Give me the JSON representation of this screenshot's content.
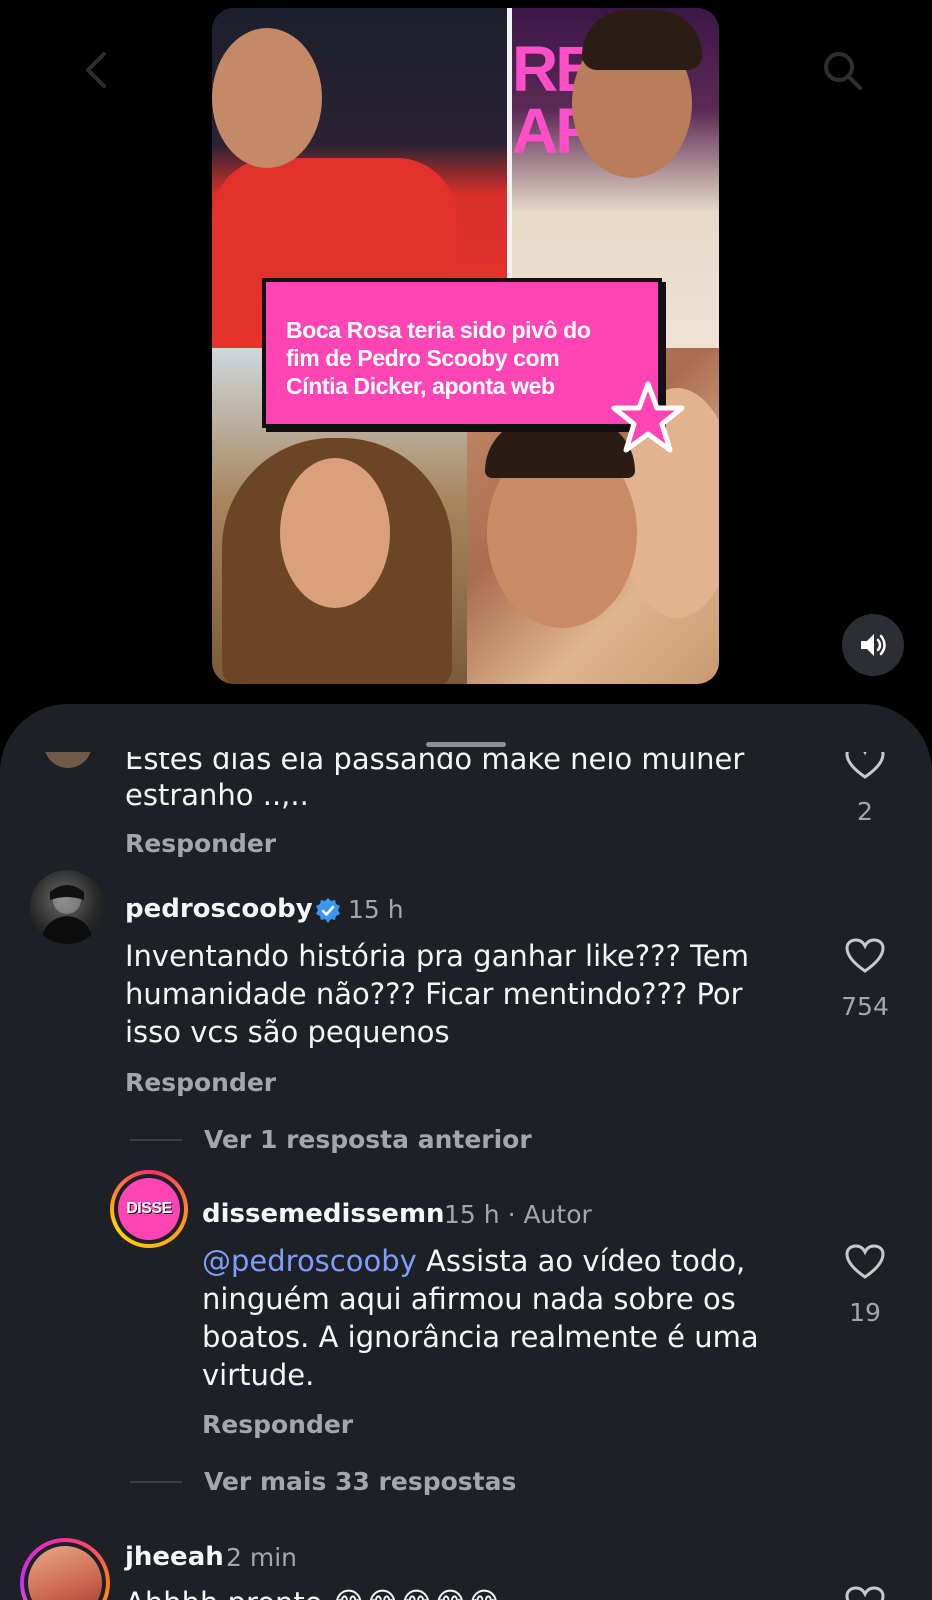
{
  "video": {
    "headline": "Boca Rosa teria sido pivô do fim de Pedro Scooby com Cíntia Dicker, aponta web",
    "bg_letters": "RBA\nAR",
    "icons": {
      "back": "chevron-left-icon",
      "search": "search-icon",
      "sound": "speaker-on-icon",
      "star": "star-icon"
    }
  },
  "comments": {
    "previous": {
      "text_fragment": "Estes dias ela passando make nelo mulher",
      "text_last_line": "estranho ..,..",
      "reply_label": "Responder",
      "like_count": "2"
    },
    "pedro": {
      "username": "pedroscooby",
      "verified": true,
      "time": "15 h",
      "text": "Inventando história pra ganhar like??? Tem humanidade não??? Ficar mentindo??? Por isso vcs são pequenos",
      "reply_label": "Responder",
      "like_count": "754",
      "view_previous": "Ver 1 resposta anterior"
    },
    "disse": {
      "username": "dissemedissemn",
      "time": "15 h",
      "author_tag": "· Autor",
      "mention": "@pedroscooby",
      "text": " Assista ao vídeo todo, ninguém aqui afirmou nada sobre os boatos. A ignorância realmente é uma virtude.",
      "reply_label": "Responder",
      "like_count": "19",
      "view_more": "Ver mais 33 respostas",
      "avatar_text": "DISSE"
    },
    "jheeah": {
      "username": "jheeah",
      "time": "2 min",
      "text": "Ahhhh pronto 😂😂😂😂😂"
    }
  },
  "colors": {
    "sheet_bg": "#1d2025",
    "accent_pink": "#ff45b5",
    "mention_blue": "#7f9cff",
    "verified_blue": "#3897f0",
    "muted_text": "#a3a6ab"
  }
}
